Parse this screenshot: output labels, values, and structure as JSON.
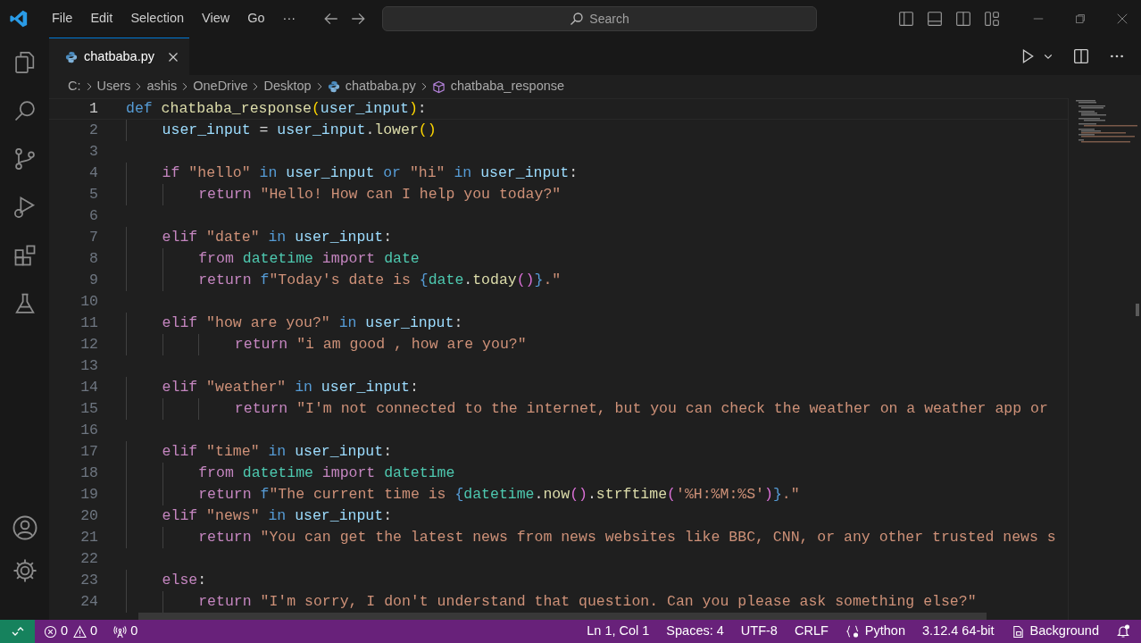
{
  "menu": [
    "File",
    "Edit",
    "Selection",
    "View",
    "Go",
    "···"
  ],
  "search": {
    "placeholder": "Search"
  },
  "tabs": [
    {
      "label": "chatbaba.py",
      "selected": true
    }
  ],
  "breadcrumb": [
    {
      "label": "C:",
      "kind": "folder"
    },
    {
      "label": "Users",
      "kind": "folder"
    },
    {
      "label": "ashis",
      "kind": "folder"
    },
    {
      "label": "OneDrive",
      "kind": "folder"
    },
    {
      "label": "Desktop",
      "kind": "folder"
    },
    {
      "label": "chatbaba.py",
      "kind": "file"
    },
    {
      "label": "chatbaba_response",
      "kind": "symbol"
    }
  ],
  "lines": [
    {
      "number": "1",
      "current": true,
      "tokens": [
        {
          "kind": "kw",
          "text": "def"
        },
        {
          "kind": "fn",
          "text": " chatbaba_response"
        },
        {
          "kind": "p1",
          "text": "("
        },
        {
          "kind": "var",
          "text": "user_input"
        },
        {
          "kind": "p1",
          "text": ")"
        },
        {
          "kind": "plain",
          "text": ":"
        }
      ]
    },
    {
      "number": "2",
      "current": false,
      "tokens": [
        {
          "kind": "var",
          "text": "    user_input"
        },
        {
          "kind": "plain",
          "text": " ="
        },
        {
          "kind": "var",
          "text": " user_input"
        },
        {
          "kind": "plain",
          "text": "."
        },
        {
          "kind": "fn",
          "text": "lower"
        },
        {
          "kind": "p1",
          "text": "()"
        }
      ]
    },
    {
      "number": "3",
      "current": false
    },
    {
      "number": "4",
      "current": false,
      "tokens": [
        {
          "kind": "ctrl",
          "text": "    if"
        },
        {
          "kind": "str",
          "text": " \"hello\""
        },
        {
          "kind": "kw",
          "text": " in"
        },
        {
          "kind": "var",
          "text": " user_input"
        },
        {
          "kind": "kw",
          "text": " or"
        },
        {
          "kind": "str",
          "text": " \"hi\""
        },
        {
          "kind": "kw",
          "text": " in"
        },
        {
          "kind": "var",
          "text": " user_input"
        },
        {
          "kind": "plain",
          "text": ":"
        }
      ]
    },
    {
      "number": "5",
      "current": false,
      "tokens": [
        {
          "kind": "ctrl",
          "text": "        return"
        },
        {
          "kind": "str",
          "text": " \"Hello! How can I help you today?\""
        }
      ]
    },
    {
      "number": "6",
      "current": false
    },
    {
      "number": "7",
      "current": false,
      "tokens": [
        {
          "kind": "ctrl",
          "text": "    elif"
        },
        {
          "kind": "str",
          "text": " \"date\""
        },
        {
          "kind": "kw",
          "text": " in"
        },
        {
          "kind": "var",
          "text": " user_input"
        },
        {
          "kind": "plain",
          "text": ":"
        }
      ]
    },
    {
      "number": "8",
      "current": false,
      "tokens": [
        {
          "kind": "ctrl",
          "text": "        from"
        },
        {
          "kind": "cls",
          "text": " datetime"
        },
        {
          "kind": "ctrl",
          "text": " import"
        },
        {
          "kind": "cls",
          "text": " date"
        }
      ]
    },
    {
      "number": "9",
      "current": false,
      "tokens": [
        {
          "kind": "ctrl",
          "text": "        return"
        },
        {
          "kind": "kw",
          "text": " f"
        },
        {
          "kind": "str",
          "text": "\"Today's date is "
        },
        {
          "kind": "kw",
          "text": "{"
        },
        {
          "kind": "cls",
          "text": "date"
        },
        {
          "kind": "plain",
          "text": "."
        },
        {
          "kind": "fn",
          "text": "today"
        },
        {
          "kind": "p2",
          "text": "()"
        },
        {
          "kind": "kw",
          "text": "}"
        },
        {
          "kind": "str",
          "text": ".\""
        }
      ]
    },
    {
      "number": "10",
      "current": false
    },
    {
      "number": "11",
      "current": false,
      "tokens": [
        {
          "kind": "ctrl",
          "text": "    elif"
        },
        {
          "kind": "str",
          "text": " \"how are you?\""
        },
        {
          "kind": "kw",
          "text": " in"
        },
        {
          "kind": "var",
          "text": " user_input"
        },
        {
          "kind": "plain",
          "text": ":"
        }
      ]
    },
    {
      "number": "12",
      "current": false,
      "tokens": [
        {
          "kind": "ctrl",
          "text": "            return"
        },
        {
          "kind": "str",
          "text": " \"i am good , how are you?\""
        }
      ]
    },
    {
      "number": "13",
      "current": false
    },
    {
      "number": "14",
      "current": false,
      "tokens": [
        {
          "kind": "ctrl",
          "text": "    elif"
        },
        {
          "kind": "str",
          "text": " \"weather\""
        },
        {
          "kind": "kw",
          "text": " in"
        },
        {
          "kind": "var",
          "text": " user_input"
        },
        {
          "kind": "plain",
          "text": ":"
        }
      ]
    },
    {
      "number": "15",
      "current": false,
      "tokens": [
        {
          "kind": "ctrl",
          "text": "            return"
        },
        {
          "kind": "str",
          "text": " \"I'm not connected to the internet, but you can check the weather on a weather app or"
        }
      ]
    },
    {
      "number": "16",
      "current": false
    },
    {
      "number": "17",
      "current": false,
      "tokens": [
        {
          "kind": "ctrl",
          "text": "    elif"
        },
        {
          "kind": "str",
          "text": " \"time\""
        },
        {
          "kind": "kw",
          "text": " in"
        },
        {
          "kind": "var",
          "text": " user_input"
        },
        {
          "kind": "plain",
          "text": ":"
        }
      ]
    },
    {
      "number": "18",
      "current": false,
      "tokens": [
        {
          "kind": "ctrl",
          "text": "        from"
        },
        {
          "kind": "cls",
          "text": " datetime"
        },
        {
          "kind": "ctrl",
          "text": " import"
        },
        {
          "kind": "cls",
          "text": " datetime"
        }
      ]
    },
    {
      "number": "19",
      "current": false,
      "tokens": [
        {
          "kind": "ctrl",
          "text": "        return"
        },
        {
          "kind": "kw",
          "text": " f"
        },
        {
          "kind": "str",
          "text": "\"The current time is "
        },
        {
          "kind": "kw",
          "text": "{"
        },
        {
          "kind": "cls",
          "text": "datetime"
        },
        {
          "kind": "plain",
          "text": "."
        },
        {
          "kind": "fn",
          "text": "now"
        },
        {
          "kind": "p2",
          "text": "()"
        },
        {
          "kind": "plain",
          "text": "."
        },
        {
          "kind": "fn",
          "text": "strftime"
        },
        {
          "kind": "p2",
          "text": "("
        },
        {
          "kind": "str",
          "text": "'%H:%M:%S'"
        },
        {
          "kind": "p2",
          "text": ")"
        },
        {
          "kind": "kw",
          "text": "}"
        },
        {
          "kind": "str",
          "text": ".\""
        }
      ]
    },
    {
      "number": "20",
      "current": false,
      "tokens": [
        {
          "kind": "ctrl",
          "text": "    elif"
        },
        {
          "kind": "str",
          "text": " \"news\""
        },
        {
          "kind": "kw",
          "text": " in"
        },
        {
          "kind": "var",
          "text": " user_input"
        },
        {
          "kind": "plain",
          "text": ":"
        }
      ]
    },
    {
      "number": "21",
      "current": false,
      "tokens": [
        {
          "kind": "ctrl",
          "text": "        return"
        },
        {
          "kind": "str",
          "text": " \"You can get the latest news from news websites like BBC, CNN, or any other trusted news s"
        }
      ]
    },
    {
      "number": "22",
      "current": false
    },
    {
      "number": "23",
      "current": false,
      "tokens": [
        {
          "kind": "ctrl",
          "text": "    else"
        },
        {
          "kind": "plain",
          "text": ":"
        }
      ]
    },
    {
      "number": "24",
      "current": false,
      "tokens": [
        {
          "kind": "ctrl",
          "text": "        return"
        },
        {
          "kind": "str",
          "text": " \"I'm sorry, I don't understand that question. Can you please ask something else?\""
        }
      ]
    }
  ],
  "status_bar": {
    "errors": "0",
    "warnings": "0",
    "ports": "0",
    "position": "Ln 1, Col 1",
    "spaces": "Spaces: 4",
    "encoding": "UTF-8",
    "eol": "CRLF",
    "language": "Python",
    "interpreter": "3.12.4 64-bit",
    "background": "Background"
  }
}
